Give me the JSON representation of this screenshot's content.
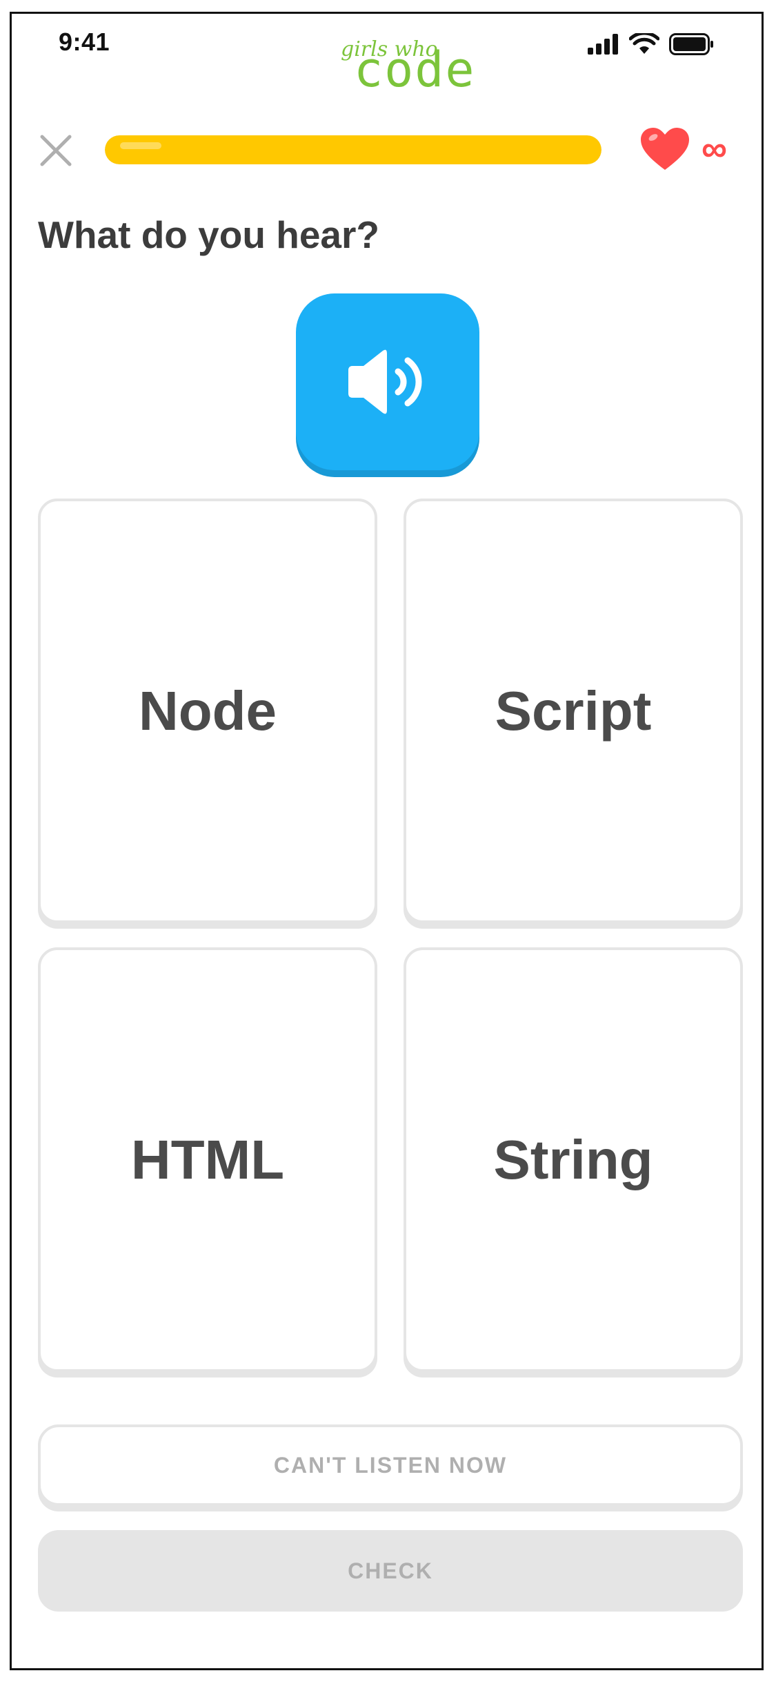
{
  "status_bar": {
    "time": "9:41",
    "icons": [
      "signal-icon",
      "wifi-icon",
      "battery-icon"
    ]
  },
  "logo": {
    "small_text": "girls who",
    "big_text": "code",
    "color": "#7cc43b"
  },
  "lesson": {
    "progress_percent": 100,
    "lives": "∞",
    "prompt": "What do you hear?",
    "options": [
      {
        "label": "Node"
      },
      {
        "label": "Script"
      },
      {
        "label": "HTML"
      },
      {
        "label": "String"
      }
    ],
    "cant_listen_label": "CAN'T LISTEN NOW",
    "check_label": "CHECK"
  },
  "colors": {
    "progress": "#ffc800",
    "speaker": "#1cb0f6",
    "heart": "#ff4b4b",
    "text": "#4b4b4b",
    "border": "#e5e5e5",
    "disabled_text": "#afafaf"
  }
}
